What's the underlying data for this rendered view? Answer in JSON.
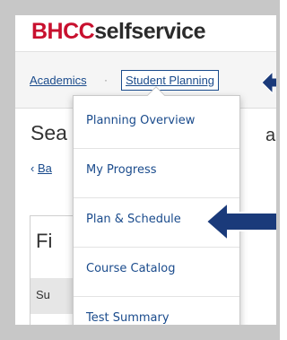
{
  "header": {
    "logo_part1": "BHCC",
    "logo_part2": "selfservice"
  },
  "breadcrumb": {
    "items": [
      "Academics",
      "Student Planning"
    ],
    "separator": "·"
  },
  "page": {
    "title_visible_left": "Sea",
    "title_visible_right": "a",
    "back_link_icon": "chevron-left-icon",
    "back_link_text": "Ba",
    "card_title_visible": "Fi",
    "card_row_visible": "Su"
  },
  "dropdown": {
    "items": [
      "Planning Overview",
      "My Progress",
      "Plan & Schedule",
      "Course Catalog",
      "Test Summary"
    ]
  },
  "annotations": {
    "arrow_color": "#1a3a7a"
  }
}
